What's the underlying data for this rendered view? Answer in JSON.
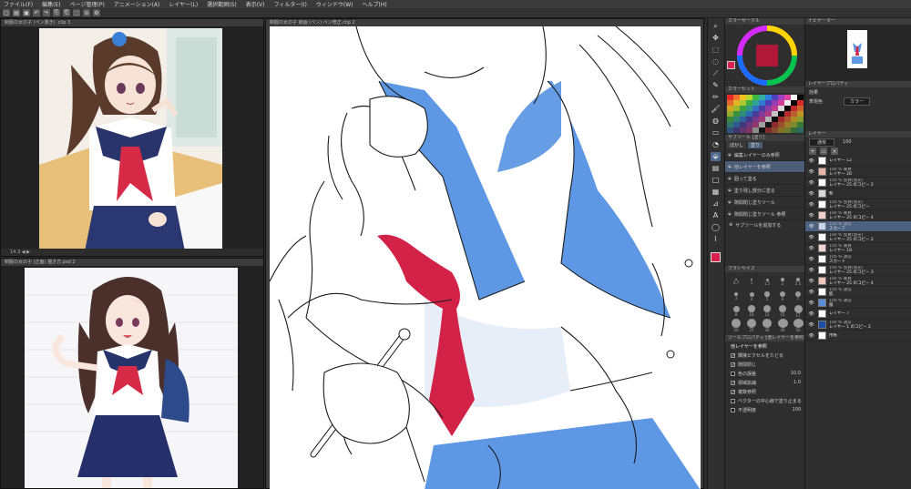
{
  "menu": {
    "items": [
      "ファイル(F)",
      "編集(E)",
      "ページ管理(P)",
      "アニメーション(A)",
      "レイヤー(L)",
      "選択範囲(S)",
      "表示(V)",
      "フィルター(I)",
      "ウィンドウ(W)",
      "ヘルプ(H)"
    ]
  },
  "toolbar": {
    "icons": [
      "new-file-icon",
      "open-file-icon",
      "save-icon",
      "undo-icon",
      "redo-icon",
      "copy-icon",
      "paste-icon",
      "transform-icon",
      "deselect-icon",
      "settings-icon"
    ]
  },
  "panes": {
    "ref1_tab": "制服の女の子 (ペン書き) .clip 3",
    "ref2_tab": "制服の女の子 (正面) 描き方.psd 2",
    "canvas_tab": "制服の女の子 線画 (ペン) ペン修正.clip 2"
  },
  "subtool": {
    "color_tab": "カラーサークル",
    "palette_tab": "カラーセット",
    "panel_tab": "サブツール [塗り]",
    "tabs": [
      "ぼかし",
      "塗り"
    ],
    "items": [
      {
        "label": "編集レイヤーのみ参照",
        "selected": false
      },
      {
        "label": "他レイヤーを参照",
        "selected": true
      },
      {
        "label": "囲って塗る",
        "selected": false
      },
      {
        "label": "塗り残し部分に塗る",
        "selected": false
      },
      {
        "label": "隙間閉じ塗りツール",
        "selected": false
      },
      {
        "label": "隙間閉じ塗りツール 参照",
        "selected": false
      }
    ],
    "add_subtool": "サブツールを追加する",
    "brush_size_tab": "ブラシサイズ",
    "brush_sizes": [
      "0.7",
      "1",
      "1.5",
      "2",
      "2.5",
      "3",
      "4",
      "5",
      "6",
      "7",
      "8",
      "10",
      "12",
      "15",
      "17",
      "20",
      "25",
      "30",
      "40",
      "50"
    ],
    "tool_props_tab": "ツールプロパティ [他レイヤーを参照]",
    "tool_props_title": "他レイヤーを参照",
    "props": [
      {
        "label": "隣接ピクセルをたどる",
        "checked": true
      },
      {
        "label": "隙間閉じ",
        "checked": true
      },
      {
        "label": "色の誤差",
        "checked": false,
        "value": "10.0"
      },
      {
        "label": "領域拡縮",
        "checked": true,
        "value": "1.0"
      },
      {
        "label": "複数参照",
        "checked": true
      },
      {
        "label": "ベクターの中心線で塗り止まる",
        "checked": false
      },
      {
        "label": "不透明度",
        "checked": false,
        "value": "100"
      }
    ]
  },
  "right": {
    "navigator_tab": "ナビゲーター",
    "layer_prop_tab": "レイヤープロパティ",
    "effect_label": "効果",
    "expression_label": "表現色",
    "expression_value": "カラー",
    "layer_tab": "レイヤー",
    "blend_mode": "通常",
    "opacity": "100",
    "layers": [
      {
        "name": "レイヤー 12",
        "mode": "",
        "thumb": "#ffffff",
        "selected": false,
        "eye": true
      },
      {
        "name": "レイヤー 26",
        "mode": "100 % 乗算",
        "thumb": "#e8b4a8",
        "selected": false,
        "eye": true
      },
      {
        "name": "レイヤー 25 のコピー 2",
        "mode": "100 % 加算(発光)",
        "thumb": "#ffffff",
        "selected": false,
        "eye": true
      },
      {
        "name": "髪",
        "mode": "",
        "thumb": "#d8d8d8",
        "selected": false,
        "eye": true
      },
      {
        "name": "レイヤー 25 のコピー",
        "mode": "100 % 加算(発光)",
        "thumb": "#ffffff",
        "selected": false,
        "eye": true
      },
      {
        "name": "レイヤー 25 のコピー 4",
        "mode": "100 % 乗算",
        "thumb": "#f0d0c8",
        "selected": false,
        "eye": true
      },
      {
        "name": "スカーフ",
        "mode": "100 % 通常",
        "thumb": "#c9d5e8",
        "selected": true,
        "eye": true
      },
      {
        "name": "レイヤー 25 のコピー 2",
        "mode": "100 % 加算(発光)",
        "thumb": "#ffffff",
        "selected": false,
        "eye": true
      },
      {
        "name": "レイヤー 18",
        "mode": "100 % 乗算",
        "thumb": "#f2d6cf",
        "selected": false,
        "eye": true
      },
      {
        "name": "スカート",
        "mode": "100 % 通常",
        "thumb": "#ffffff",
        "selected": false,
        "eye": true
      },
      {
        "name": "レイヤー 25 のコピー 3",
        "mode": "100 % 加算(発光)",
        "thumb": "#ffffff",
        "selected": false,
        "eye": true
      },
      {
        "name": "レイヤー 25 のコピー 4",
        "mode": "100 % 乗算",
        "thumb": "#f1c5bb",
        "selected": false,
        "eye": true
      },
      {
        "name": "肌",
        "mode": "100 % 通常",
        "thumb": "#ffffff",
        "selected": false,
        "eye": true
      },
      {
        "name": "服",
        "mode": "100 % 通常",
        "thumb": "#5b8fdb",
        "selected": false,
        "eye": true
      },
      {
        "name": "レイヤー 7",
        "mode": "",
        "thumb": "#ffffff",
        "selected": false,
        "eye": true
      },
      {
        "name": "レイヤー 1 のコピー 2",
        "mode": "100 % 通常",
        "thumb": "#1e4fa8",
        "selected": false,
        "eye": true
      },
      {
        "name": "用紙",
        "mode": "",
        "thumb": "#ffffff",
        "selected": false,
        "eye": true
      }
    ]
  },
  "colors": {
    "main": "#d8224c",
    "sub": "#ffffff",
    "fill_blue": "#5e98e4",
    "scarf_red": "#d32248",
    "selection": "#4b6282"
  }
}
